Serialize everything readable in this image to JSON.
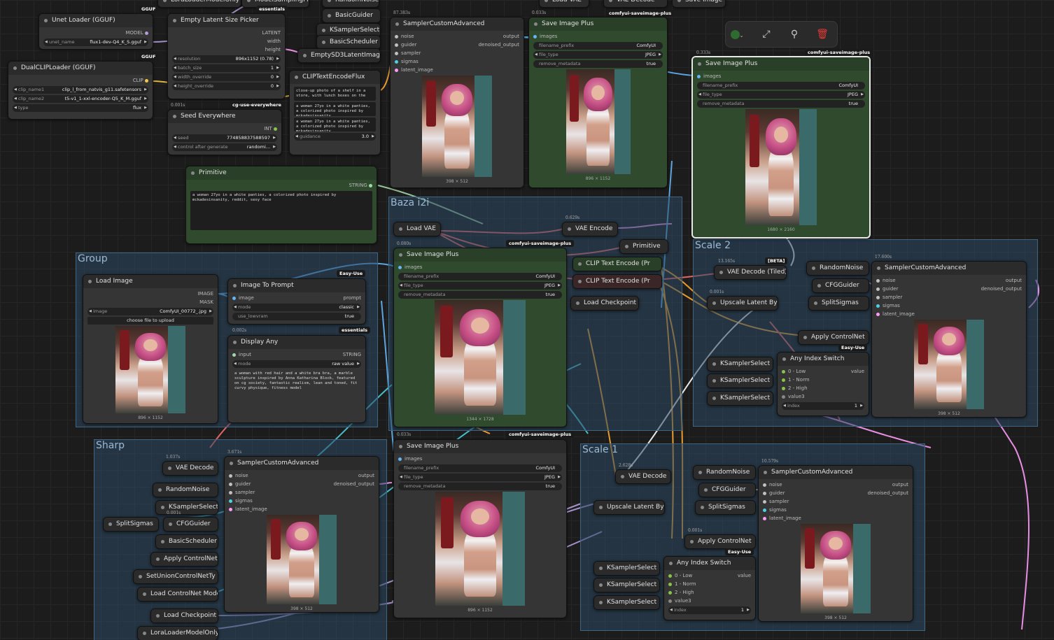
{
  "toolbar": {
    "color_icon": "green-circle-icon",
    "bypass_icon": "bypass-icon",
    "pin_icon": "pin-icon",
    "delete_icon": "trash-icon"
  },
  "groups": {
    "group": "Group",
    "baza": "Baza i2i",
    "scale2": "Scale 2",
    "sharp": "Sharp",
    "scale1": "Scale 1"
  },
  "top_cut": {
    "lora": "LoraLoaderModelOnly",
    "model_sampling": "ModelSamplingFlux",
    "random_noise": "RandomNoise",
    "load_vae": "Load VAE",
    "vae_decode": "VAE Decode",
    "save_image": "Save Image"
  },
  "badges": {
    "gguf": "GGUF",
    "essentials": "essentials",
    "cg": "cg-use-everywhere",
    "comfyui_save": "comfyui-saveimage-plus",
    "easy_use": "Easy-Use",
    "beta": "[BETA]"
  },
  "unet": {
    "title": "Unet Loader (GGUF)",
    "model": "MODEL",
    "unet_name_label": "unet_name",
    "unet_name": "flux1-dev-Q4_K_S.gguf"
  },
  "dualclip": {
    "title": "DualCLIPLoader (GGUF)",
    "clip": "CLIP",
    "clip_name1_label": "clip_name1",
    "clip_name1": "clip_l_from_natvis_g11.safetensors",
    "clip_name2_label": "clip_name2",
    "clip_name2": "t5-v1_1-xxl-encoder-Q5_K_M.gguf",
    "type_label": "type",
    "type": "flux"
  },
  "latent_picker": {
    "title": "Empty Latent Size Picker",
    "latent": "LATENT",
    "width": "width",
    "height": "height",
    "resolution_label": "resolution",
    "resolution": "896x1152 (0.78)",
    "batch_label": "batch_size",
    "batch": "1",
    "width_ov_label": "width_override",
    "width_ov": "0",
    "height_ov_label": "height_override",
    "height_ov": "0"
  },
  "seed": {
    "timing": "0.001s",
    "title": "Seed Everywhere",
    "int": "INT",
    "seed_label": "seed",
    "seed": "774858837588597",
    "control_label": "control after generate",
    "control": "randomi..."
  },
  "mid_col": {
    "basic_guider": "BasicGuider",
    "ksampler_select": "KSamplerSelect",
    "basic_scheduler": "BasicScheduler",
    "empty_sd3": "EmptySD3LatentImage"
  },
  "clip_flux": {
    "title": "CLIPTextEncodeFlux",
    "text1": "close-up photo of a shelf in a store, with lunch boxes on the",
    "text2": "a woman 27yo in a white panties, a colorized photo inspired by mckadesinsanity",
    "text3": "a woman 27yo in a white panties, a colorized photo inspired by mckadesinsanity",
    "guidance_label": "guidance",
    "guidance": "3.0"
  },
  "primitive": {
    "title": "Primitive",
    "string": "STRING",
    "text": "a woman 27yo in a white panties, a colorized photo inspired by mckadesinsanity, reddit, sexy face"
  },
  "sca_top": {
    "timing": "87.383s",
    "title": "SamplerCustomAdvanced",
    "noise": "noise",
    "guider": "guider",
    "sampler": "sampler",
    "sigmas": "sigmas",
    "latent": "latent_image",
    "output": "output",
    "denoised": "denoised_output",
    "size": "398 × 512"
  },
  "save_top": {
    "timing": "0.033s",
    "title": "Save Image Plus",
    "images": "images",
    "prefix_label": "filename_prefix",
    "prefix": "ComfyUI",
    "ftype_label": "file_type",
    "ftype": "JPEG",
    "meta_label": "remove_metadata",
    "meta": "true",
    "size": "896 × 1152"
  },
  "save_sel": {
    "timing": "0.333s",
    "title": "Save Image Plus",
    "images": "images",
    "prefix_label": "filename_prefix",
    "prefix": "ComfyUI",
    "ftype_label": "file_type",
    "ftype": "JPEG",
    "meta_label": "remove_metadata",
    "meta": "true",
    "size": "1680 × 2160"
  },
  "baza": {
    "load_vae": "Load VAE",
    "timing_vae": "0.629s",
    "vae_encode": "VAE Encode",
    "primitive": "Primitive",
    "clip1": "CLIP Text Encode (Pr",
    "clip2": "CLIP Text Encode (Pr",
    "load_ckpt": "Load Checkpoint",
    "save_timing": "0.080s",
    "save_title": "Save Image Plus",
    "images": "images",
    "prefix_label": "filename_prefix",
    "prefix": "ComfyUI",
    "ftype_label": "file_type",
    "ftype": "JPEG",
    "meta_label": "remove_metadata",
    "meta": "true",
    "size": "1344 × 1728"
  },
  "load_image": {
    "title": "Load Image",
    "image": "IMAGE",
    "mask": "MASK",
    "image_label": "image",
    "image_val": "ComfyUI_00772_.jpg",
    "upload": "choose file to upload",
    "size": "896 × 1152"
  },
  "img2prompt": {
    "title": "Image To Prompt",
    "image": "image",
    "prompt": "prompt",
    "mode_label": "mode",
    "mode": "classic",
    "lowvram_label": "use_lowvram",
    "lowvram": "true"
  },
  "display_any": {
    "timing": "0.002s",
    "title": "Display Any",
    "input": "input",
    "string": "STRING",
    "mode_label": "mode",
    "mode": "raw value",
    "text": "a woman with red hair and a white bra bra, a marble sculpture inspired by Anna Katharina Block, featured on cg society, fantastic realism, lean and toned, fit curvy physique, fitness model"
  },
  "scale2": {
    "vae_timing": "13.165s",
    "vae_tiled": "VAE Decode (Tiled)",
    "random_noise": "RandomNoise",
    "sca_timing": "17.600s",
    "sca": "SamplerCustomAdvanced",
    "upscale_timing": "0.001s",
    "upscale": "Upscale Latent By",
    "cfg": "CFGGuider",
    "split": "SplitSigmas",
    "apply_cn": "Apply ControlNet",
    "ks1": "KSamplerSelect",
    "ks2": "KSamplerSelect",
    "ks3": "KSamplerSelect",
    "ais": "Any Index Switch",
    "low": "0 - Low",
    "norm": "1 - Norm",
    "high": "2 - High",
    "value3": "value3",
    "value": "value",
    "index_label": "index",
    "index": "1",
    "noise": "noise",
    "guider": "guider",
    "sampler": "sampler",
    "sigmas": "sigmas",
    "latent": "latent_image",
    "output": "output",
    "denoised": "denoised_output",
    "size": "398 × 512"
  },
  "sharp": {
    "vae_timing": "1.037s",
    "vae": "VAE Decode",
    "random_noise": "RandomNoise",
    "ks": "KSamplerSelect",
    "cfg_timing": "0.001s",
    "cfg": "CFGGuider",
    "split": "SplitSigmas",
    "basic_sched": "BasicScheduler",
    "apply_cn": "Apply ControlNet",
    "set_union": "SetUnionControlNetTy",
    "load_cn": "Load ControlNet Mode",
    "load_ckpt": "Load Checkpoint",
    "lora": "LoraLoaderModelOnly",
    "sca_timing": "3.671s",
    "sca": "SamplerCustomAdvanced",
    "noise": "noise",
    "guider": "guider",
    "sampler": "sampler",
    "sigmas": "sigmas",
    "latent": "latent_image",
    "output": "output",
    "denoised": "denoised_output",
    "size": "398 × 512"
  },
  "save_bottom": {
    "timing": "0.033s",
    "title": "Save Image Plus",
    "images": "images",
    "prefix_label": "filename_prefix",
    "prefix": "ComfyUI",
    "ftype_label": "file_type",
    "ftype": "JPEG",
    "meta_label": "remove_metadata",
    "meta": "true",
    "size": "896 × 1152"
  },
  "scale1": {
    "vae_timing": "2.628s",
    "vae": "VAE Decode",
    "random_noise": "RandomNoise",
    "sca_timing": "10.579s",
    "sca": "SamplerCustomAdvanced",
    "upscale": "Upscale Latent By",
    "cfg": "CFGGuider",
    "split": "SplitSigmas",
    "cn_timing": "0.001s",
    "apply_cn": "Apply ControlNet",
    "ks1": "KSamplerSelect",
    "ks2": "KSamplerSelect",
    "ks3": "KSamplerSelect",
    "ais": "Any Index Switch",
    "low": "0 - Low",
    "norm": "1 - Norm",
    "high": "2 - High",
    "value3": "value3",
    "value": "value",
    "index_label": "index",
    "index": "1",
    "noise": "noise",
    "guider": "guider",
    "sampler": "sampler",
    "sigmas": "sigmas",
    "latent": "latent_image",
    "output": "output",
    "denoised": "denoised_output",
    "size": "398 × 512"
  },
  "colors": {
    "clip": "#f5c842",
    "model": "#b39ddb",
    "latent": "#ff9cf9",
    "image": "#64b5f6",
    "vae": "#ff6e6e",
    "conditioning": "#ffa931",
    "int": "#8bc34a",
    "noise": "#c0c0c0",
    "sigmas": "#4dd0e1"
  }
}
